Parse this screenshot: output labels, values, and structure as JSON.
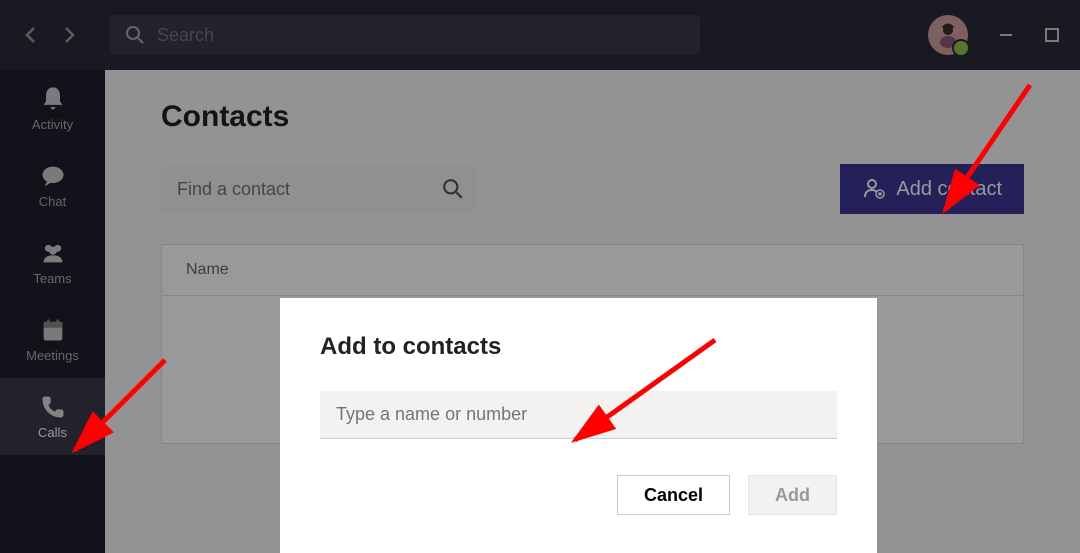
{
  "header": {
    "search_placeholder": "Search"
  },
  "sidebar": {
    "items": [
      {
        "label": "Activity"
      },
      {
        "label": "Chat"
      },
      {
        "label": "Teams"
      },
      {
        "label": "Meetings"
      },
      {
        "label": "Calls"
      }
    ]
  },
  "page": {
    "title": "Contacts",
    "find_placeholder": "Find a contact",
    "add_button": "Add contact",
    "table": {
      "col_name": "Name"
    }
  },
  "dialog": {
    "title": "Add to contacts",
    "input_placeholder": "Type a name or number",
    "cancel": "Cancel",
    "add": "Add"
  }
}
